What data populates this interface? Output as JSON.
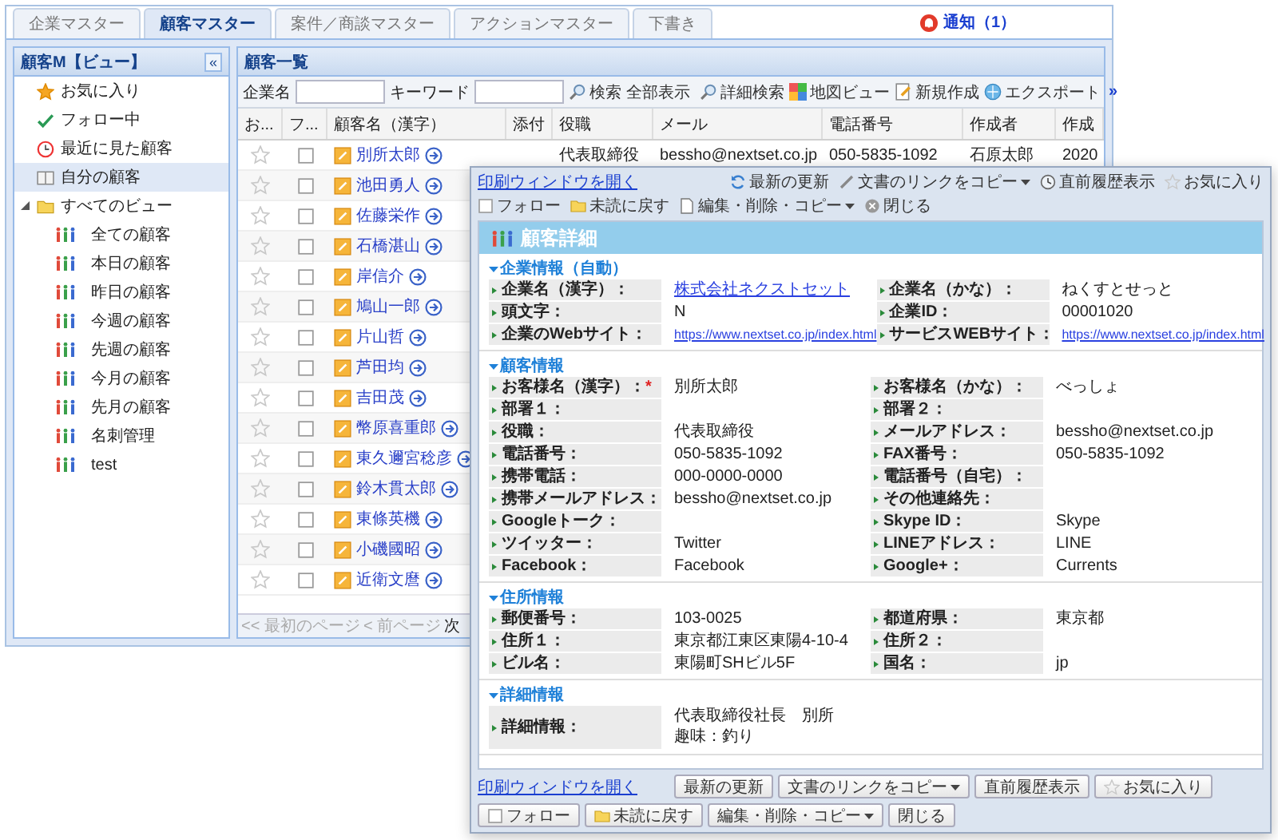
{
  "tabs": [
    {
      "label": "企業マスター",
      "selected": false
    },
    {
      "label": "顧客マスター",
      "selected": true
    },
    {
      "label": "案件／商談マスター",
      "selected": false
    },
    {
      "label": "アクションマスター",
      "selected": false
    },
    {
      "label": "下書き",
      "selected": false
    }
  ],
  "notification": {
    "label": "通知（1）"
  },
  "sidebar": {
    "title": "顧客M【ビュー】",
    "collapse": "«",
    "items": [
      {
        "label": "お気に入り",
        "kind": "star",
        "selected": false
      },
      {
        "label": "フォロー中",
        "kind": "check",
        "selected": false
      },
      {
        "label": "最近に見た顧客",
        "kind": "clock",
        "selected": false
      },
      {
        "label": "自分の顧客",
        "kind": "book",
        "selected": true
      },
      {
        "label": "すべてのビュー",
        "kind": "folder",
        "selected": false,
        "expanded": true,
        "children": [
          {
            "label": "全ての顧客",
            "kind": "people",
            "selected": false
          },
          {
            "label": "本日の顧客",
            "kind": "people",
            "selected": false
          },
          {
            "label": "昨日の顧客",
            "kind": "people",
            "selected": false
          },
          {
            "label": "今週の顧客",
            "kind": "people",
            "selected": false
          },
          {
            "label": "先週の顧客",
            "kind": "people",
            "selected": false
          },
          {
            "label": "今月の顧客",
            "kind": "people",
            "selected": false
          },
          {
            "label": "先月の顧客",
            "kind": "people",
            "selected": false
          },
          {
            "label": "名刺管理",
            "kind": "people",
            "selected": false
          },
          {
            "label": "test",
            "kind": "people",
            "selected": false
          }
        ]
      }
    ]
  },
  "list": {
    "title": "顧客一覧",
    "fields": [
      {
        "label": "企業名"
      },
      {
        "label": "キーワード"
      }
    ],
    "actions": [
      {
        "label": "検索",
        "kind": "search"
      },
      {
        "label": "全部表示",
        "kind": "plain"
      }
    ],
    "tools": [
      {
        "label": "詳細検索",
        "kind": "search"
      },
      {
        "label": "地図ビュー",
        "kind": "map"
      },
      {
        "label": "新規作成",
        "kind": "new"
      },
      {
        "label": "エクスポート",
        "kind": "export"
      }
    ],
    "more": "»",
    "columns": [
      "お...",
      "フ...",
      "顧客名（漢字）",
      "添付",
      "役職",
      "メール",
      "電話番号",
      "作成者",
      "作成"
    ],
    "rows": [
      {
        "favorite": false,
        "followed": false,
        "name": "別所太郎",
        "title": "代表取締役",
        "email": "bessho@nextset.co.jp",
        "phone": "050-5835-1092",
        "creator": "石原太郎",
        "created": "2020"
      },
      {
        "favorite": false,
        "followed": false,
        "name": "池田勇人"
      },
      {
        "favorite": false,
        "followed": false,
        "name": "佐藤栄作"
      },
      {
        "favorite": false,
        "followed": false,
        "name": "石橋湛山"
      },
      {
        "favorite": false,
        "followed": false,
        "name": "岸信介"
      },
      {
        "favorite": false,
        "followed": false,
        "name": "鳩山一郎"
      },
      {
        "favorite": false,
        "followed": false,
        "name": "片山哲"
      },
      {
        "favorite": false,
        "followed": false,
        "name": "芦田均"
      },
      {
        "favorite": false,
        "followed": false,
        "name": "吉田茂"
      },
      {
        "favorite": false,
        "followed": false,
        "name": "幣原喜重郎"
      },
      {
        "favorite": false,
        "followed": false,
        "name": "東久邇宮稔彦"
      },
      {
        "favorite": false,
        "followed": false,
        "name": "鈴木貫太郎"
      },
      {
        "favorite": false,
        "followed": false,
        "name": "東條英機"
      },
      {
        "favorite": false,
        "followed": false,
        "name": "小磯國昭"
      },
      {
        "favorite": false,
        "followed": false,
        "name": "近衛文麿"
      }
    ],
    "pager": [
      {
        "label": "<< 最初のページ",
        "disabled": true
      },
      {
        "label": "< 前ページ",
        "disabled": true
      },
      {
        "label": "次",
        "disabled": false
      }
    ]
  },
  "detail": {
    "toolbar": {
      "link": "印刷ウィンドウを開く",
      "buttons": [
        {
          "label": "最新の更新",
          "kind": "refresh",
          "menu": false
        },
        {
          "label": "文書のリンクをコピー",
          "kind": "pen",
          "menu": true
        },
        {
          "label": "直前履歴表示",
          "kind": "history",
          "menu": false
        },
        {
          "label": "お気に入り",
          "kind": "star",
          "menu": false
        },
        {
          "label": "フォロー",
          "kind": "checkbox",
          "menu": false
        },
        {
          "label": "未読に戻す",
          "kind": "folder",
          "menu": false
        },
        {
          "label": "編集・削除・コピー",
          "kind": "doc",
          "menu": true
        },
        {
          "label": "閉じる",
          "kind": "close",
          "menu": false
        }
      ]
    },
    "title": "顧客詳細",
    "sections": [
      {
        "title": "企業情報（自動）",
        "expanded": true,
        "fields": [
          {
            "label": "企業名（漢字）：",
            "link": "株式会社ネクストセット"
          },
          {
            "label": "企業名（かな）：",
            "value": "ねくすとせっと"
          },
          {
            "label": "頭文字：",
            "value": "N"
          },
          {
            "label": "企業ID：",
            "value": "00001020"
          },
          {
            "label": "企業のWebサイト：",
            "link": "https://www.nextset.co.jp/index.html"
          },
          {
            "label": "サービスWEBサイト：",
            "link": "https://www.nextset.co.jp/index.html"
          }
        ]
      },
      {
        "title": "顧客情報",
        "expanded": true,
        "fields": [
          {
            "label": "お客様名（漢字）：",
            "mark": "*",
            "value": "別所太郎"
          },
          {
            "label": "お客様名（かな）：",
            "value": "べっしょ"
          },
          {
            "label": "部署１："
          },
          {
            "label": "部署２："
          },
          {
            "label": "役職：",
            "value": "代表取締役"
          },
          {
            "label": "メールアドレス：",
            "value": "bessho@nextset.co.jp"
          },
          {
            "label": "電話番号：",
            "value": "050-5835-1092"
          },
          {
            "label": "FAX番号：",
            "value": "050-5835-1092"
          },
          {
            "label": "携帯電話：",
            "value": "000-0000-0000"
          },
          {
            "label": "電話番号（自宅）："
          },
          {
            "label": "携帯メールアドレス：",
            "value": "bessho@nextset.co.jp"
          },
          {
            "label": "その他連絡先："
          },
          {
            "label": "Googleトーク："
          },
          {
            "label": "Skype ID：",
            "value": "Skype"
          },
          {
            "label": "ツイッター：",
            "value": "Twitter"
          },
          {
            "label": "LINEアドレス：",
            "value": "LINE"
          },
          {
            "label": "Facebook：",
            "value": "Facebook"
          },
          {
            "label": "Google+：",
            "value": "Currents"
          }
        ]
      },
      {
        "title": "住所情報",
        "expanded": true,
        "fields": [
          {
            "label": "郵便番号：",
            "value": "103-0025"
          },
          {
            "label": "都道府県：",
            "value": "東京都"
          },
          {
            "label": "住所１：",
            "value": "東京都江東区東陽4-10-4"
          },
          {
            "label": "住所２："
          },
          {
            "label": "ビル名：",
            "value": "東陽町SHビル5F"
          },
          {
            "label": "国名：",
            "value": "jp"
          }
        ]
      },
      {
        "title": "詳細情報",
        "expanded": true,
        "fields": [
          {
            "label": "詳細情報：",
            "lines": [
              "代表取締役社長　別所",
              "趣味：釣り"
            ]
          }
        ]
      }
    ],
    "footer": {
      "link": "印刷ウィンドウを開く",
      "buttons": [
        {
          "label": "最新の更新",
          "kind": "plain",
          "menu": false
        },
        {
          "label": "文書のリンクをコピー",
          "kind": "plain",
          "menu": true
        },
        {
          "label": "直前履歴表示",
          "kind": "plain",
          "menu": false
        },
        {
          "label": "お気に入り",
          "kind": "star",
          "menu": false
        },
        {
          "label": "フォロー",
          "kind": "checkbox",
          "menu": false
        },
        {
          "label": "未読に戻す",
          "kind": "folder",
          "menu": false
        },
        {
          "label": "編集・削除・コピー",
          "kind": "plain",
          "menu": true
        },
        {
          "label": "閉じる",
          "kind": "plain",
          "menu": false
        }
      ]
    }
  }
}
